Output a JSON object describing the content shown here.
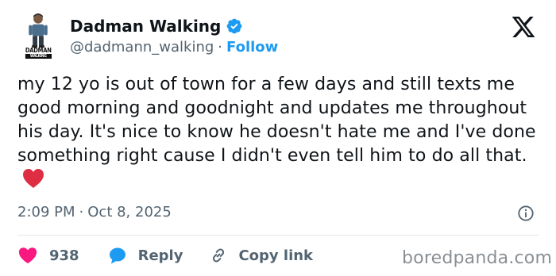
{
  "author": {
    "display_name": "Dadman Walking",
    "handle": "@dadmann_walking",
    "separator": "·",
    "follow_label": "Follow",
    "avatar_text_line1": "DADMAN",
    "avatar_text_line2": "WALKING"
  },
  "tweet": {
    "text": "my 12 yo is out of town for a few days and still texts me good morning and goodnight and updates me throughout his day. It's nice to know he doesn't hate me and I've done something right cause I didn't even tell him to do all that.",
    "time": "2:09 PM",
    "separator": "·",
    "date": "Oct 8, 2025"
  },
  "actions": {
    "like_count": "938",
    "reply_label": "Reply",
    "copy_label": "Copy link"
  },
  "watermark": "boredpanda.com",
  "colors": {
    "brand_blue": "#1d9bf0",
    "heart_pink": "#f91880",
    "text_dark": "#0f1419",
    "text_gray": "#536471"
  }
}
